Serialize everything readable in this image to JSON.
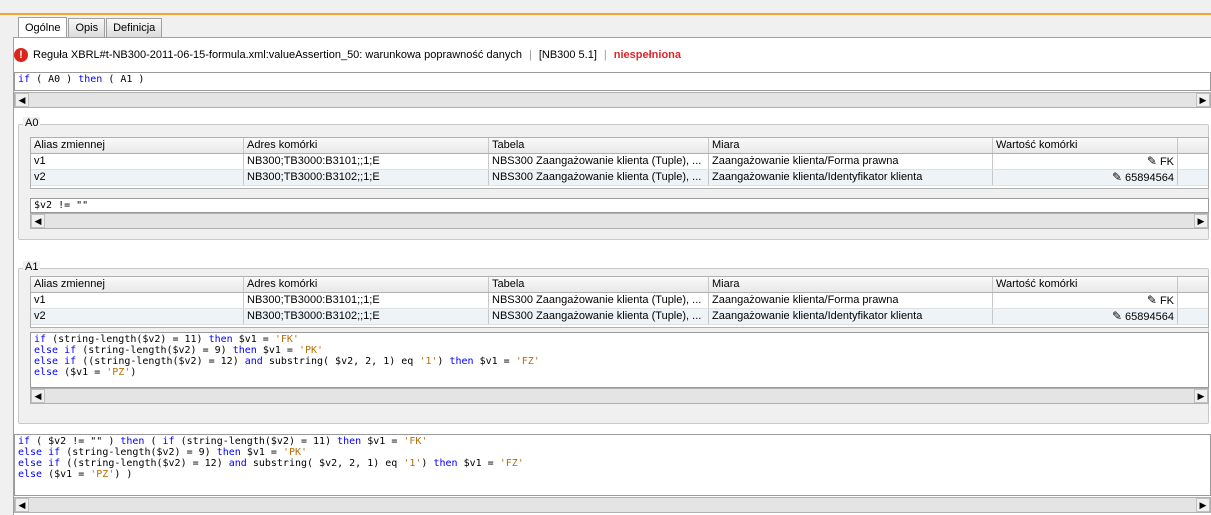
{
  "tabs": [
    {
      "label": "Ogólne"
    },
    {
      "label": "Opis"
    },
    {
      "label": "Definicja"
    }
  ],
  "rule": {
    "icon": "error-icon",
    "title": "Reguła XBRL#t-NB300-2011-06-15-formula.xml:valueAssertion_50: warunkowa poprawność danych",
    "code": "[NB300 5.1]",
    "status": "niespełniona"
  },
  "top_expr": "if ( A0 ) then ( A1 )",
  "columns": [
    "Alias zmiennej",
    "Adres komórki",
    "Tabela",
    "Miara",
    "Wartość komórki"
  ],
  "A0": {
    "title": "A0",
    "rows": [
      {
        "alias": "v1",
        "address": "NB300;TB3000:B3101;;1;E",
        "table": "NBS300 Zaangażowanie klienta (Tuple), ...",
        "measure": "Zaangażowanie klienta/Forma prawna",
        "value": "FK"
      },
      {
        "alias": "v2",
        "address": "NB300;TB3000:B3102;;1;E",
        "table": "NBS300 Zaangażowanie klienta (Tuple), ...",
        "measure": "Zaangażowanie klienta/Identyfikator klienta",
        "value": "65894564"
      }
    ],
    "expr": "$v2 != \"\""
  },
  "A1": {
    "title": "A1",
    "rows": [
      {
        "alias": "v1",
        "address": "NB300;TB3000:B3101;;1;E",
        "table": "NBS300 Zaangażowanie klienta (Tuple), ...",
        "measure": "Zaangażowanie klienta/Forma prawna",
        "value": "FK"
      },
      {
        "alias": "v2",
        "address": "NB300;TB3000:B3102;;1;E",
        "table": "NBS300 Zaangażowanie klienta (Tuple), ...",
        "measure": "Zaangażowanie klienta/Identyfikator klienta",
        "value": "65894564"
      }
    ],
    "expr_lines": [
      "if (string-length($v2) = 11) then $v1 = 'FK'",
      "else if (string-length($v2) = 9) then $v1 = 'PK'",
      "else if ((string-length($v2) = 12) and substring( $v2, 2, 1) eq '1') then $v1 = 'FZ'",
      "else ($v1 = 'PZ')"
    ]
  },
  "full_expr_lines": [
    "if ( $v2 != \"\" ) then ( if (string-length($v2) = 11) then $v1 = 'FK'",
    "else if (string-length($v2) = 9) then $v1 = 'PK'",
    "else if ((string-length($v2) = 12) and substring( $v2, 2, 1) eq '1') then $v1 = 'FZ'",
    "else ($v1 = 'PZ') )"
  ],
  "colors": {
    "accent": "#f2a531",
    "error": "#e0252a",
    "keyword": "#0000ff",
    "string": "#b86d00"
  }
}
